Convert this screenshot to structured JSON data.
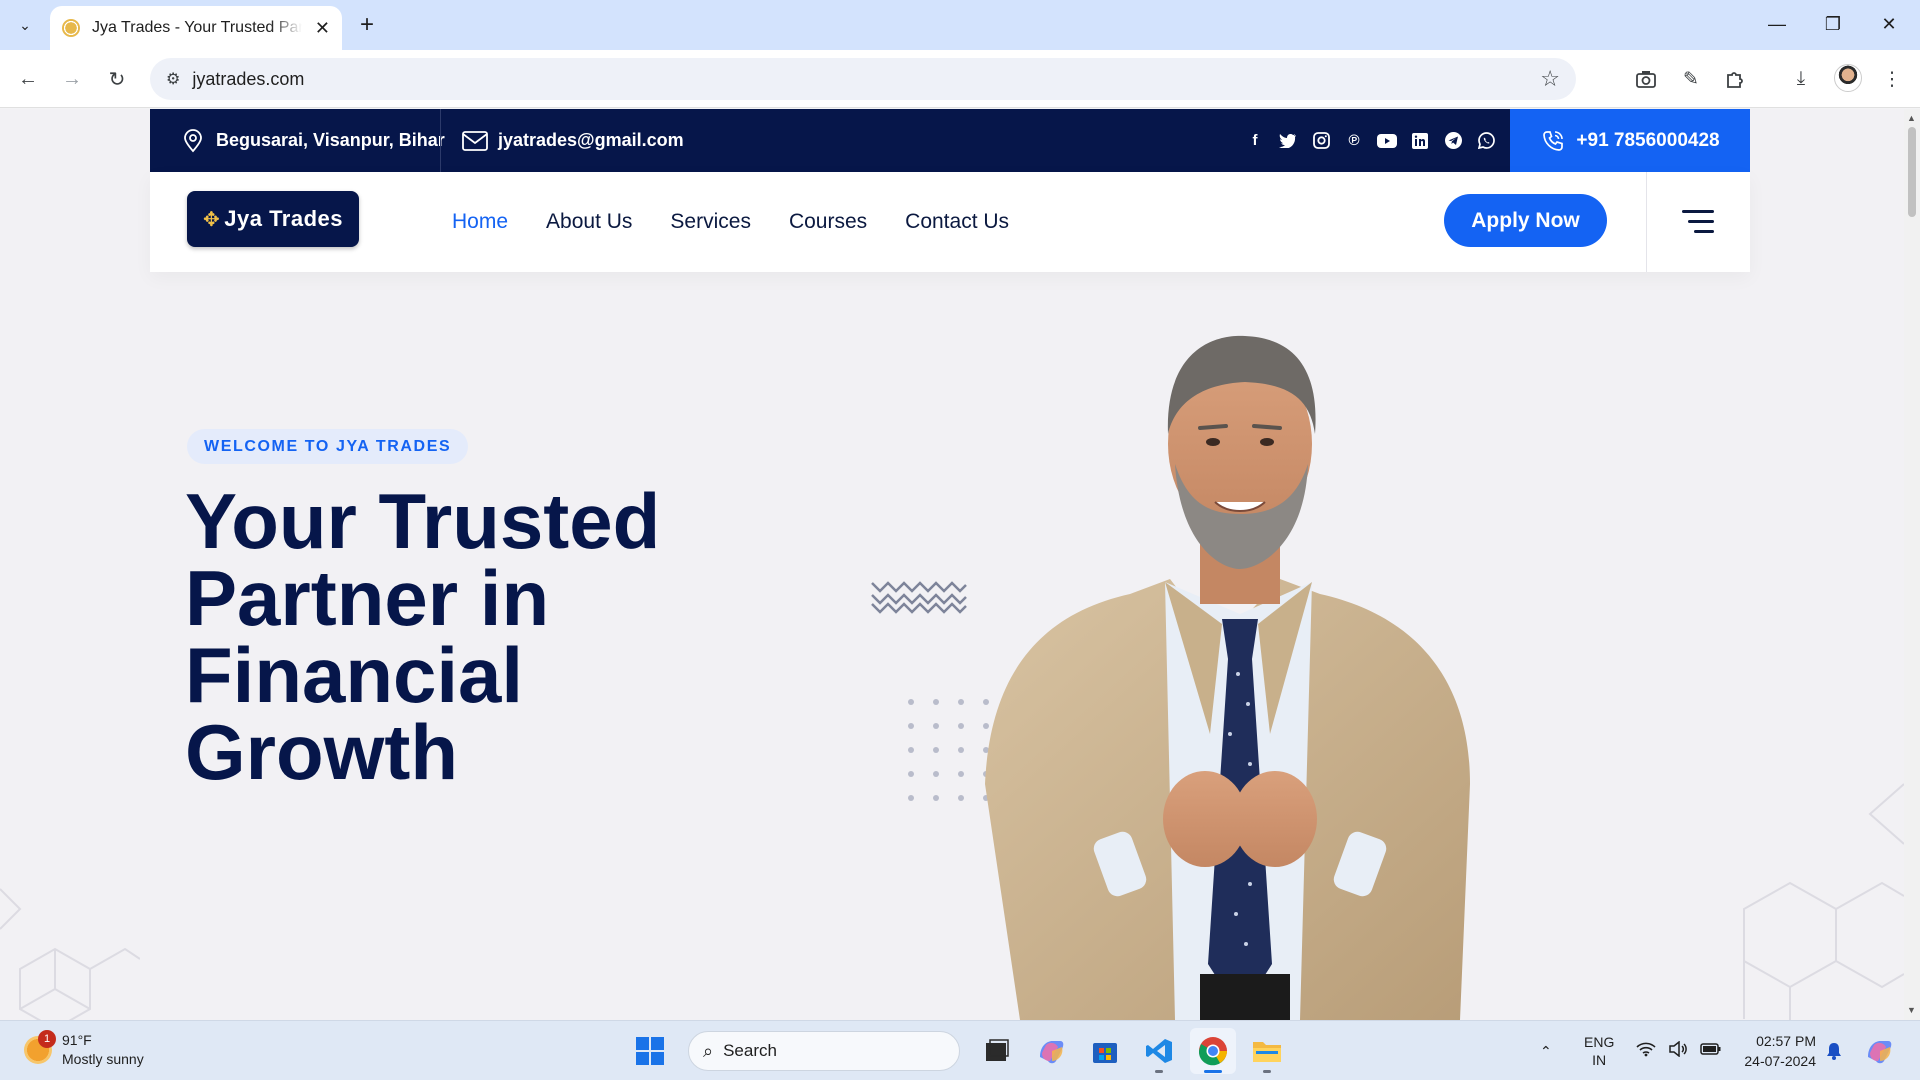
{
  "browser": {
    "tab_title": "Jya Trades - Your Trusted Partne",
    "url": "jyatrades.com"
  },
  "topbar": {
    "address": "Begusarai, Visanpur, Bihar",
    "email": "jyatrades@gmail.com",
    "phone": "+91 7856000428",
    "socials": [
      "facebook-icon",
      "twitter-icon",
      "instagram-icon",
      "pinterest-icon",
      "youtube-icon",
      "linkedin-icon",
      "telegram-icon",
      "whatsapp-icon"
    ]
  },
  "navbar": {
    "logo_text": "Jya Trades",
    "links": [
      {
        "label": "Home",
        "active": true
      },
      {
        "label": "About Us"
      },
      {
        "label": "Services"
      },
      {
        "label": "Courses"
      },
      {
        "label": "Contact Us"
      }
    ],
    "cta": "Apply Now"
  },
  "hero": {
    "badge": "WELCOME TO JYA TRADES",
    "title_lines": [
      "Your Trusted",
      "Partner in",
      "Financial",
      "Growth"
    ]
  },
  "colors": {
    "navy": "#06164a",
    "accent_blue": "#1463f3",
    "badge_bg": "#e4ebfb"
  },
  "taskbar": {
    "weather_badge": "1",
    "temperature": "91°F",
    "weather": "Mostly sunny",
    "search_label": "Search",
    "language": "ENG",
    "region": "IN",
    "time": "02:57 PM",
    "date": "24-07-2024"
  }
}
